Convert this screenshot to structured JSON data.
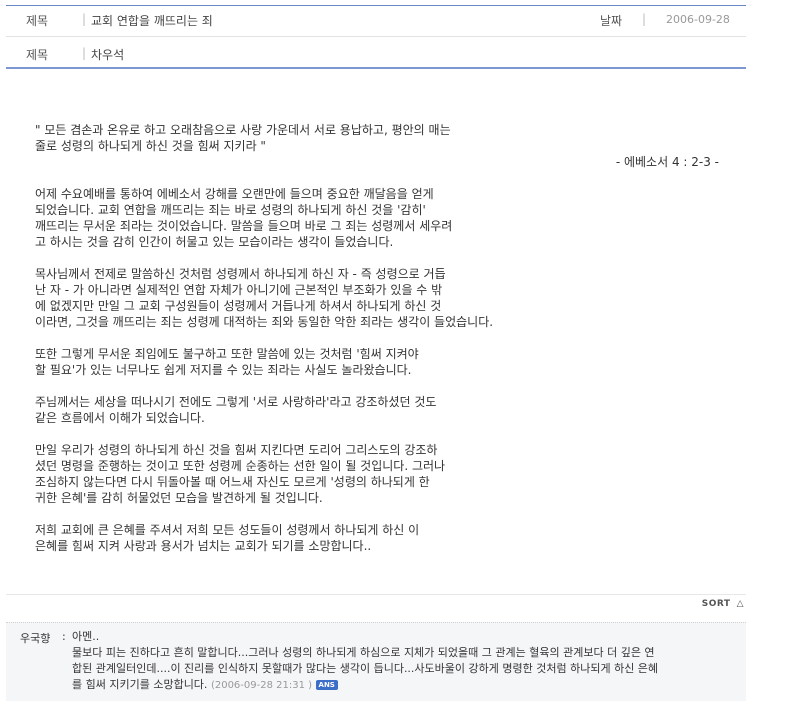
{
  "header": {
    "title_label": "제목",
    "title_sep": "|",
    "title_value": "교회 연합을 깨뜨리는 죄",
    "date_label": "날짜",
    "date_sep": "|",
    "date_value": "2006-09-28",
    "author_label": "제목",
    "author_sep": "|",
    "author_value": "차우석"
  },
  "post": {
    "quote_l1": "\" 모든 겸손과 온유로 하고 오래참음으로 사랑 가운데서 서로 용납하고, 평안의 매는",
    "quote_l2": "줄로 성령의 하나되게 하신 것을 힘써 지키라 \"",
    "quote_ref": "- 에베소서 4 : 2-3 -",
    "p1_l1": "어제 수요예배를 통하여 에베소서 강해를 오랜만에 들으며 중요한 깨달음을 얻게",
    "p1_l2": "되었습니다.   교회 연합을 깨뜨리는 죄는 바로 성령의 하나되게 하신 것을 '감히'",
    "p1_l3": "깨뜨리는 무서운 죄라는 것이었습니다. 말씀을 들으며 바로 그 죄는 성령께서 세우려",
    "p1_l4": "고 하시는 것을 감히 인간이 허물고 있는 모습이라는 생각이 들었습니다.",
    "p2_l1": "목사님께서 전제로 말씀하신 것처럼 성령께서 하나되게 하신 자 - 즉 성령으로 거듭",
    "p2_l2": "난 자 - 가 아니라면 실제적인 연합 자체가 아니기에 근본적인 부조화가 있을 수 밖",
    "p2_l3": "에 없겠지만 만일 그 교회 구성원들이 성령께서 거듭나게 하셔서 하나되게 하신 것",
    "p2_l4": "이라면, 그것을 깨뜨리는 죄는 성령께 대적하는 죄와 동일한 악한 죄라는 생각이 들었습니다.",
    "p3_l1": "또한 그렇게 무서운 죄임에도 불구하고 또한 말씀에 있는 것처럼 '힘써 지켜야",
    "p3_l2": "할 필요'가 있는 너무나도 쉽게 저지를 수 있는 죄라는 사실도 놀라왔습니다.",
    "p4_l1": "주님께서는 세상을 떠나시기 전에도 그렇게 '서로 사랑하라'라고 강조하셨던 것도",
    "p4_l2": "같은 흐름에서 이해가 되었습니다.",
    "p5_l1": "만일 우리가 성령의 하나되게 하신 것을 힘써 지킨다면 도리어 그리스도의 강조하",
    "p5_l2": "셨던 명령을 준행하는 것이고 또한 성령께 순종하는 선한 일이 될 것입니다. 그러나",
    "p5_l3": "조심하지 않는다면 다시 뒤돌아볼 때 어느새 자신도 모르게 '성령의 하나되게 한",
    "p5_l4": "귀한 은혜'를 감히 허물었던 모습을 발견하게 될 것입니다.",
    "p6_l1": "저희 교회에 큰 은혜를 주셔서 저희 모든 성도들이 성령께서 하나되게 하신 이",
    "p6_l2": "은혜를 힘써 지켜 사랑과 용서가 넘치는 교회가 되기를 소망합니다.."
  },
  "sort": {
    "label": "SORT",
    "icon": "△"
  },
  "comment": {
    "author": "우국향",
    "colon": ":",
    "l1": "아멘..",
    "l2": "물보다 피는 진하다고 흔히 말합니다...그러나 성령의 하나되게 하심으로 지체가 되었을때 그 관계는 혈육의 관계보다 더 깊은 연",
    "l3": "합된 관계일터인데....이 진리를 인식하지 못할때가 많다는 생각이 듭니다...사도바울이 강하게 명령한 것처럼 하나되게 하신 은혜",
    "l4": "를 힘써 지키기를 소망합니다.",
    "timestamp": "(2006-09-28 21:31 )",
    "badge": "ANS"
  }
}
